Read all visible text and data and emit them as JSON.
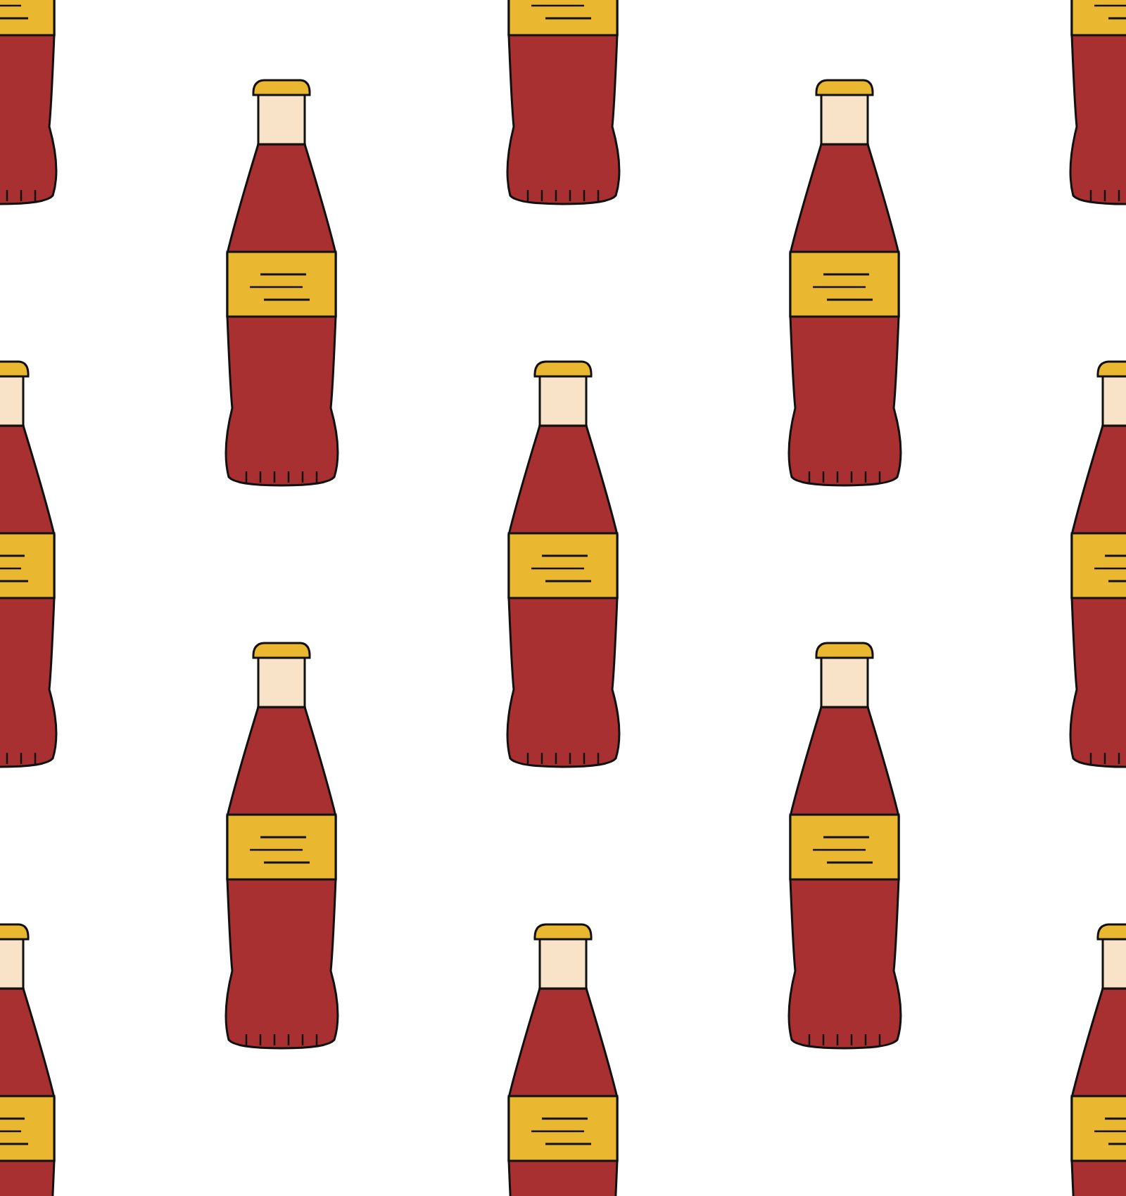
{
  "illustration": {
    "kind": "bottle-pattern"
  }
}
